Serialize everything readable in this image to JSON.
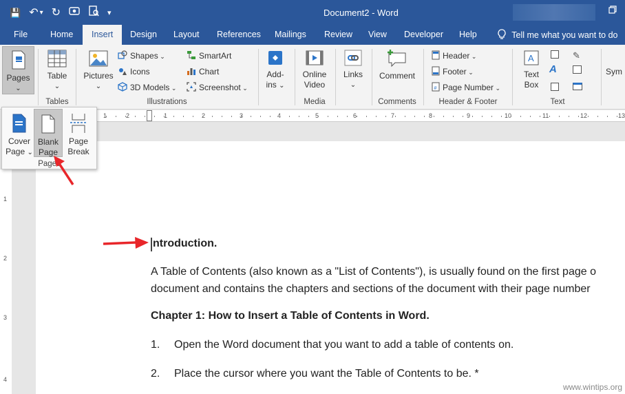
{
  "window": {
    "title": "Document2  -  Word",
    "qat": {
      "save": "💾",
      "undo": "↶",
      "undo_dropdown": "▾",
      "redo": "↻",
      "customize": "▾"
    }
  },
  "tabs": [
    {
      "label": "File"
    },
    {
      "label": "Home"
    },
    {
      "label": "Insert"
    },
    {
      "label": "Design"
    },
    {
      "label": "Layout"
    },
    {
      "label": "References"
    },
    {
      "label": "Mailings"
    },
    {
      "label": "Review"
    },
    {
      "label": "View"
    },
    {
      "label": "Developer"
    },
    {
      "label": "Help"
    }
  ],
  "tell_me": "Tell me what you want to do",
  "ribbon": {
    "pages": {
      "label": "Pages",
      "caret": "⌄"
    },
    "tables": {
      "table": "Table",
      "caret": "⌄",
      "group": "Tables"
    },
    "illustrations": {
      "pictures": "Pictures",
      "pictures_caret": "⌄",
      "shapes": "Shapes",
      "icons": "Icons",
      "models": "3D Models",
      "smartart": "SmartArt",
      "chart": "Chart",
      "screenshot": "Screenshot",
      "group": "Illustrations"
    },
    "addins": {
      "line1": "Add-",
      "line2": "ins",
      "caret": "⌄"
    },
    "media": {
      "line1": "Online",
      "line2": "Video",
      "group": "Media"
    },
    "links": {
      "label": "Links",
      "caret": "⌄"
    },
    "comments": {
      "label": "Comment",
      "group": "Comments"
    },
    "header_footer": {
      "header": "Header",
      "footer": "Footer",
      "page_number": "Page Number",
      "group": "Header & Footer"
    },
    "text": {
      "line1": "Text",
      "line2": "Box",
      "group": "Text"
    },
    "symbols": {
      "label": "Sym"
    }
  },
  "pages_dropdown": {
    "cover_l1": "Cover",
    "cover_l2": "Page",
    "cover_caret": "⌄",
    "blank_l1": "Blank",
    "blank_l2": "Page",
    "break_l1": "Page",
    "break_l2": "Break",
    "group": "Pages"
  },
  "ruler": {
    "h_ticks": [
      "1",
      "2",
      "1",
      "2",
      "3",
      "4",
      "5",
      "6",
      "7",
      "8",
      "9",
      "10",
      "11",
      "12",
      "13"
    ],
    "v_ticks": [
      "1",
      "2",
      "3",
      "4"
    ]
  },
  "document": {
    "heading": "ntroduction.",
    "para1_l1": "A Table of Contents (also known as a \"List of Contents\"), is usually found on the first page o",
    "para1_l2": "document and contains the chapters and sections of the document with their page number",
    "chapter": "Chapter 1: How to Insert a Table of Contents in Word.",
    "item1_num": "1.",
    "item1": "Open the Word document that you want to add a table of contents on.",
    "item2_num": "2.",
    "item2": "Place the cursor where you want the Table of Contents to be. *"
  },
  "watermark": "www.wintips.org",
  "colors": {
    "brand": "#2b579a",
    "arrow": "#e8262a"
  }
}
